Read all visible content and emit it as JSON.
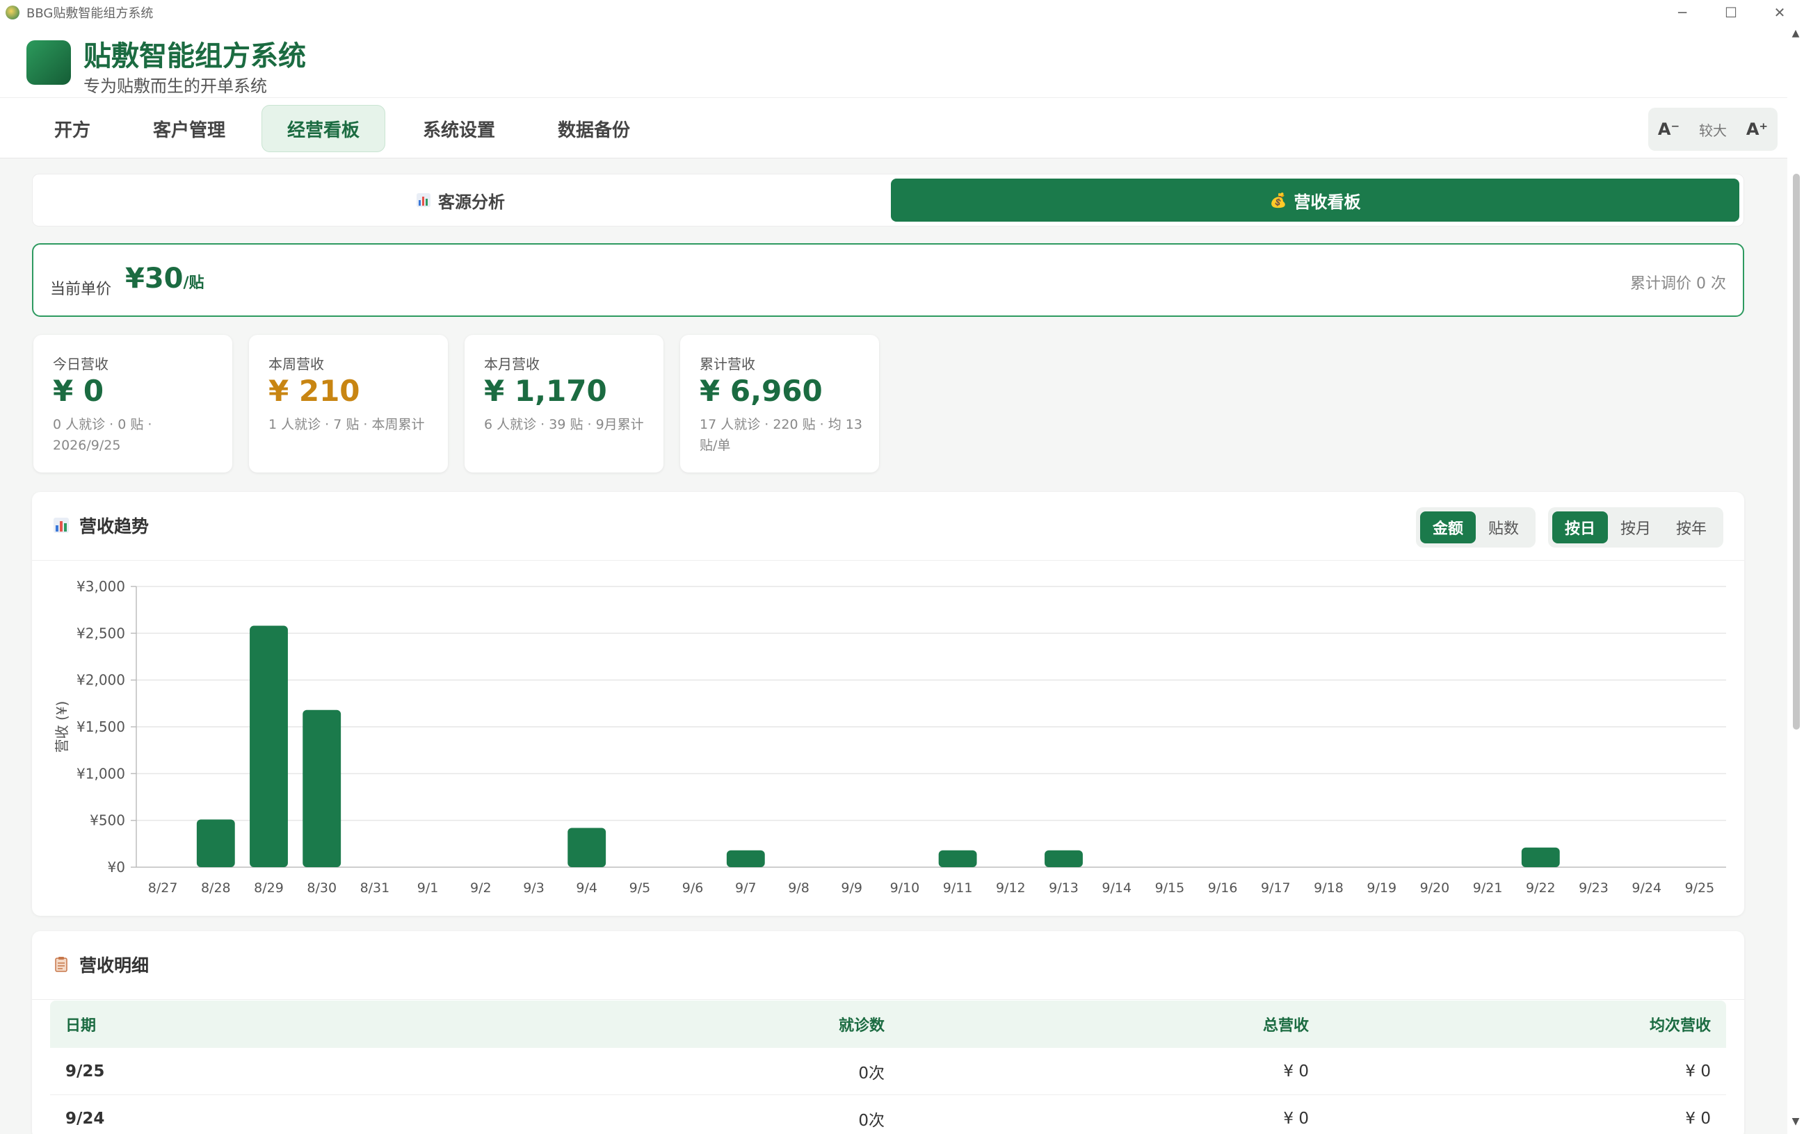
{
  "window": {
    "title": "BBG贴敷智能组方系统",
    "controls": [
      "─",
      "☐",
      "✕"
    ]
  },
  "brand": {
    "title": "贴敷智能组方系统",
    "subtitle": "专为贴敷而生的开单系统"
  },
  "nav": {
    "tabs": [
      {
        "label": "开方"
      },
      {
        "label": "客户管理"
      },
      {
        "label": "经营看板",
        "active": true
      },
      {
        "label": "系统设置"
      },
      {
        "label": "数据备份"
      }
    ],
    "font": {
      "decrease": "A⁻",
      "current": "较大",
      "increase": "A⁺"
    }
  },
  "subtabs": [
    {
      "label": "客源分析",
      "icon": "bar-chart-icon"
    },
    {
      "label": "营收看板",
      "icon": "money-bag-icon",
      "active": true
    }
  ],
  "price": {
    "label": "当前单价",
    "value": "¥30",
    "unit": "/贴",
    "adjust": "累计调价 0 次"
  },
  "stats": [
    {
      "label": "今日营收",
      "value": "¥ 0",
      "desc": "0 人就诊 · 0 贴 · 2026/9/25",
      "color": "#1b6b41"
    },
    {
      "label": "本周营收",
      "value": "¥ 210",
      "desc": "1 人就诊 · 7 贴 · 本周累计",
      "color": "#c88512"
    },
    {
      "label": "本月营收",
      "value": "¥ 1,170",
      "desc": "6 人就诊 · 39 贴 · 9月累计",
      "color": "#1b6b41"
    },
    {
      "label": "累计营收",
      "value": "¥ 6,960",
      "desc": "17 人就诊 · 220 贴 · 均 13 贴/单",
      "color": "#1b6b41"
    }
  ],
  "trend": {
    "title": "营收趋势",
    "metric_toggle": [
      "金额",
      "贴数"
    ],
    "period_toggle": [
      "按日",
      "按月",
      "按年"
    ]
  },
  "chart_data": {
    "type": "bar",
    "ylabel": "营收 (¥)",
    "ylim": [
      0,
      3000
    ],
    "yticks": [
      "¥0",
      "¥500",
      "¥1,000",
      "¥1,500",
      "¥2,000",
      "¥2,500",
      "¥3,000"
    ],
    "grid": true,
    "color": "#1b7a4b",
    "categories": [
      "8/27",
      "8/28",
      "8/29",
      "8/30",
      "8/31",
      "9/1",
      "9/2",
      "9/3",
      "9/4",
      "9/5",
      "9/6",
      "9/7",
      "9/8",
      "9/9",
      "9/10",
      "9/11",
      "9/12",
      "9/13",
      "9/14",
      "9/15",
      "9/16",
      "9/17",
      "9/18",
      "9/19",
      "9/20",
      "9/21",
      "9/22",
      "9/23",
      "9/24",
      "9/25"
    ],
    "values": [
      0,
      510,
      2580,
      1680,
      0,
      0,
      0,
      0,
      420,
      0,
      0,
      180,
      0,
      0,
      0,
      180,
      0,
      180,
      0,
      0,
      0,
      0,
      0,
      0,
      0,
      0,
      210,
      0,
      0,
      0
    ]
  },
  "detail": {
    "title": "营收明细",
    "headers": [
      "日期",
      "就诊数",
      "总营收",
      "均次营收"
    ],
    "rows": [
      [
        "9/25",
        "0次",
        "¥ 0",
        "¥ 0"
      ],
      [
        "9/24",
        "0次",
        "¥ 0",
        "¥ 0"
      ]
    ]
  }
}
